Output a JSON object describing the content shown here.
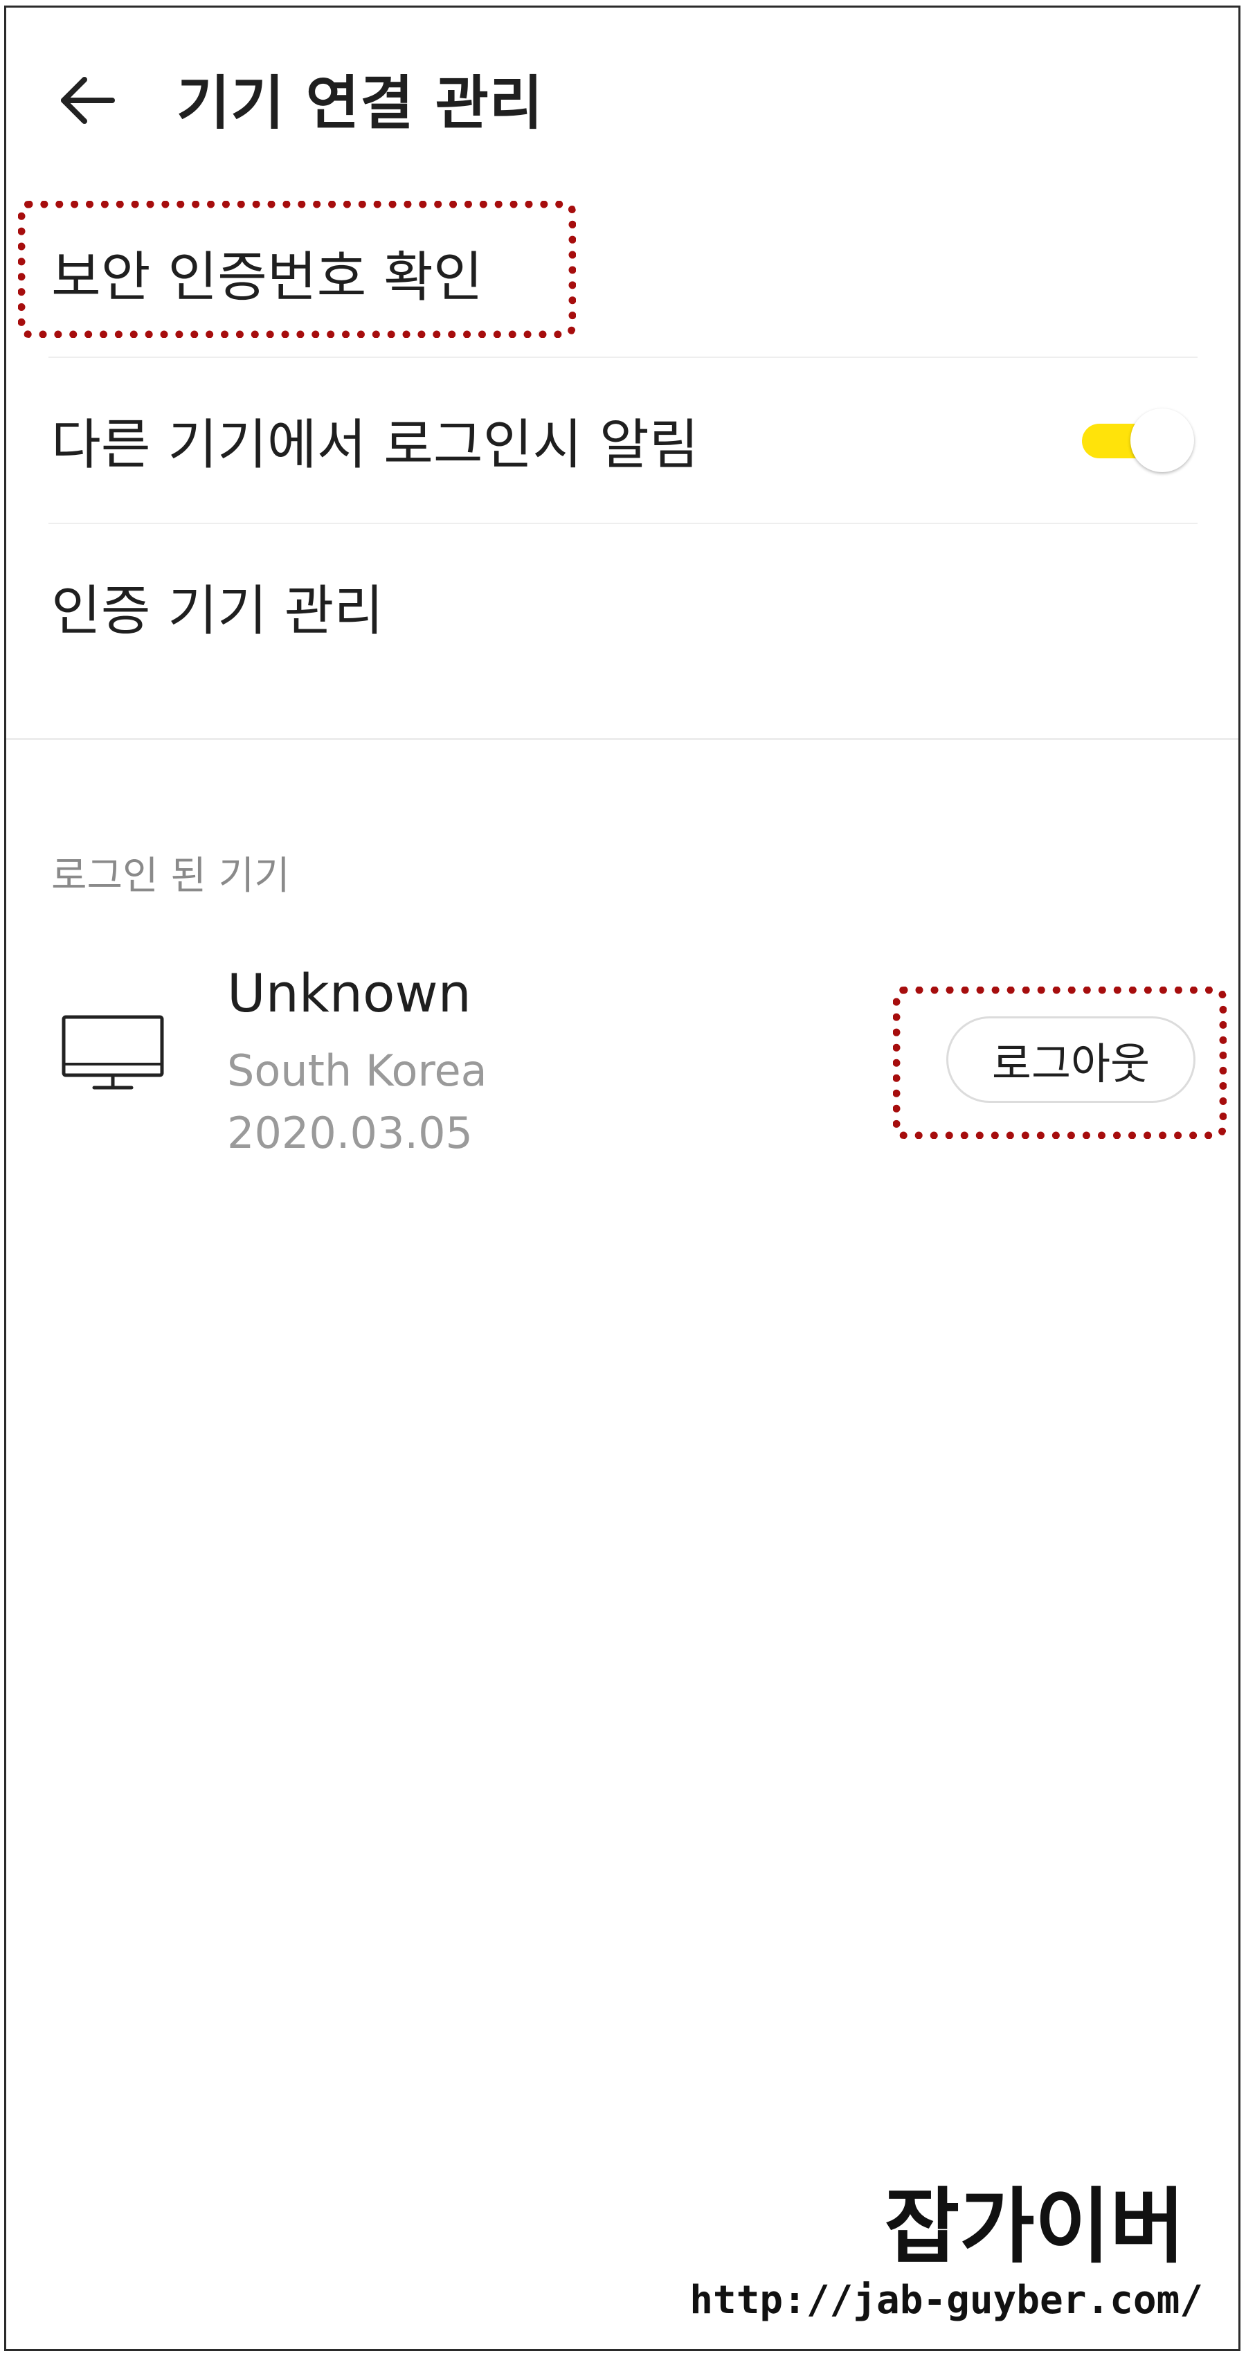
{
  "header": {
    "back_icon": "arrow-left-icon",
    "title": "기기 연결 관리"
  },
  "settings": {
    "items": [
      {
        "label": "보안 인증번호 확인"
      },
      {
        "label": "다른 기기에서 로그인시 알림",
        "toggle_on": true
      },
      {
        "label": "인증 기기 관리"
      }
    ]
  },
  "logged_in": {
    "section_title": "로그인 된 기기",
    "devices": [
      {
        "icon": "desktop-monitor-icon",
        "name": "Unknown",
        "location": "South Korea",
        "date": "2020.03.05",
        "logout_label": "로그아웃"
      }
    ]
  },
  "watermark": {
    "title": "잡가이버",
    "url": "http://jab-guyber.com/"
  },
  "colors": {
    "toggle_on": "#ffe30a",
    "annotation": "#a60d0d",
    "secondary_text": "#9a9a9a"
  }
}
